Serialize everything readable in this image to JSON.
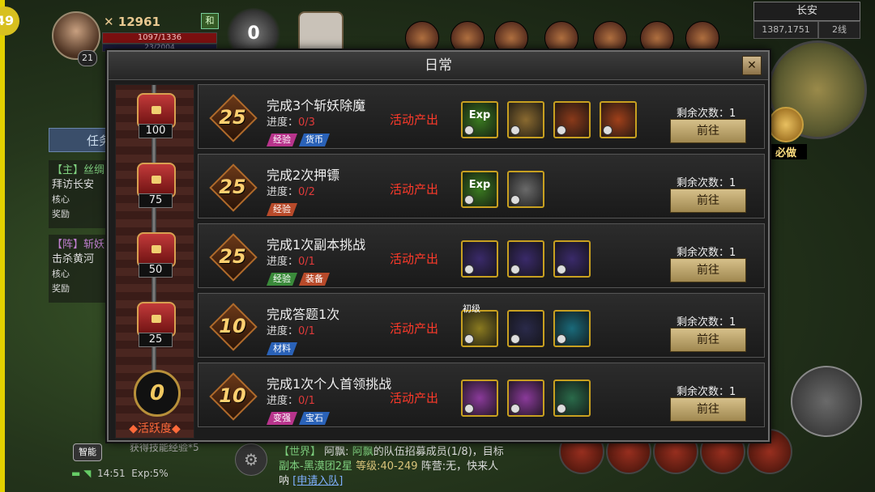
{
  "hud": {
    "player_level": "21",
    "combat_power": "12961",
    "hp_text": "1097/1336",
    "mp_text": "23/2004",
    "mode": "和",
    "score": "0",
    "city": "长安",
    "coords": "1387,1751",
    "line": "2线",
    "must_do": "必做",
    "task_tab": "任务",
    "quest1_head": "【主】丝绸",
    "quest1_body": "拜访长安",
    "quest1_core": "核心奖励",
    "quest2_head": "【阵】斩妖",
    "quest2_body": "击杀黄河",
    "quest2_core": "核心奖励",
    "auto_btn": "智能",
    "skill_hint": "获得技能经验*5",
    "time": "14:51",
    "exp": "Exp:5%",
    "level_corner": "49"
  },
  "chat": {
    "channel": "【世界】",
    "sender": "阿飘:",
    "msg1_name": "阿飘",
    "msg1_text": "的队伍招募成员(1/8)，目标",
    "msg2_a": "副本-黑漠团2星",
    "msg2_b": "等级:40-249",
    "msg2_c": "阵营:无，快来人",
    "msg3_a": "呐",
    "msg3_link": "[申请入队]"
  },
  "modal": {
    "title": "日常",
    "close": "✕",
    "activity_value": "0",
    "activity_label": "◆活跃度◆",
    "chests": [
      "100",
      "75",
      "50",
      "25"
    ],
    "progress_label": "进度：",
    "source_label": "活动产出",
    "remain_label": "剩余次数：1",
    "go_label": "前往",
    "tasks": [
      {
        "points": "25",
        "name": "完成3个斩妖除魔",
        "progress": "0/3",
        "tags": [
          {
            "text": "经验",
            "color": "#b8348c"
          },
          {
            "text": "货币",
            "color": "#2a62b8"
          }
        ],
        "rewards": [
          {
            "color": "#3a7a20",
            "label": "Exp"
          },
          {
            "color": "#8a6a30",
            "label": ""
          },
          {
            "color": "#8a3a1a",
            "label": ""
          },
          {
            "color": "#a0401a",
            "label": ""
          }
        ]
      },
      {
        "points": "25",
        "name": "完成2次押镖",
        "progress": "0/2",
        "tags": [
          {
            "text": "经验",
            "color": "#b84a2a"
          }
        ],
        "rewards": [
          {
            "color": "#3a7a20",
            "label": "Exp"
          },
          {
            "color": "#6a6a6a",
            "label": ""
          }
        ]
      },
      {
        "points": "25",
        "name": "完成1次副本挑战",
        "progress": "0/1",
        "tags": [
          {
            "text": "经验",
            "color": "#3a8a3a"
          },
          {
            "text": "装备",
            "color": "#b84a2a"
          }
        ],
        "rewards": [
          {
            "color": "#3a2a6a",
            "label": ""
          },
          {
            "color": "#3a2a6a",
            "label": ""
          },
          {
            "color": "#3a2a6a",
            "label": ""
          }
        ]
      },
      {
        "points": "10",
        "name": "完成答题1次",
        "progress": "0/1",
        "tags": [
          {
            "text": "材料",
            "color": "#2a62b8"
          }
        ],
        "rewards": [
          {
            "color": "#8a7a20",
            "label": "",
            "pre": "初级"
          },
          {
            "color": "#2a2a4a",
            "label": ""
          },
          {
            "color": "#1a6a7a",
            "label": ""
          }
        ]
      },
      {
        "points": "10",
        "name": "完成1次个人首领挑战",
        "progress": "0/1",
        "tags": [
          {
            "text": "变强",
            "color": "#b8348c"
          },
          {
            "text": "宝石",
            "color": "#2a62b8"
          }
        ],
        "rewards": [
          {
            "color": "#8a3a9a",
            "label": ""
          },
          {
            "color": "#8a3a9a",
            "label": ""
          },
          {
            "color": "#2a6a4a",
            "label": ""
          }
        ]
      }
    ]
  }
}
